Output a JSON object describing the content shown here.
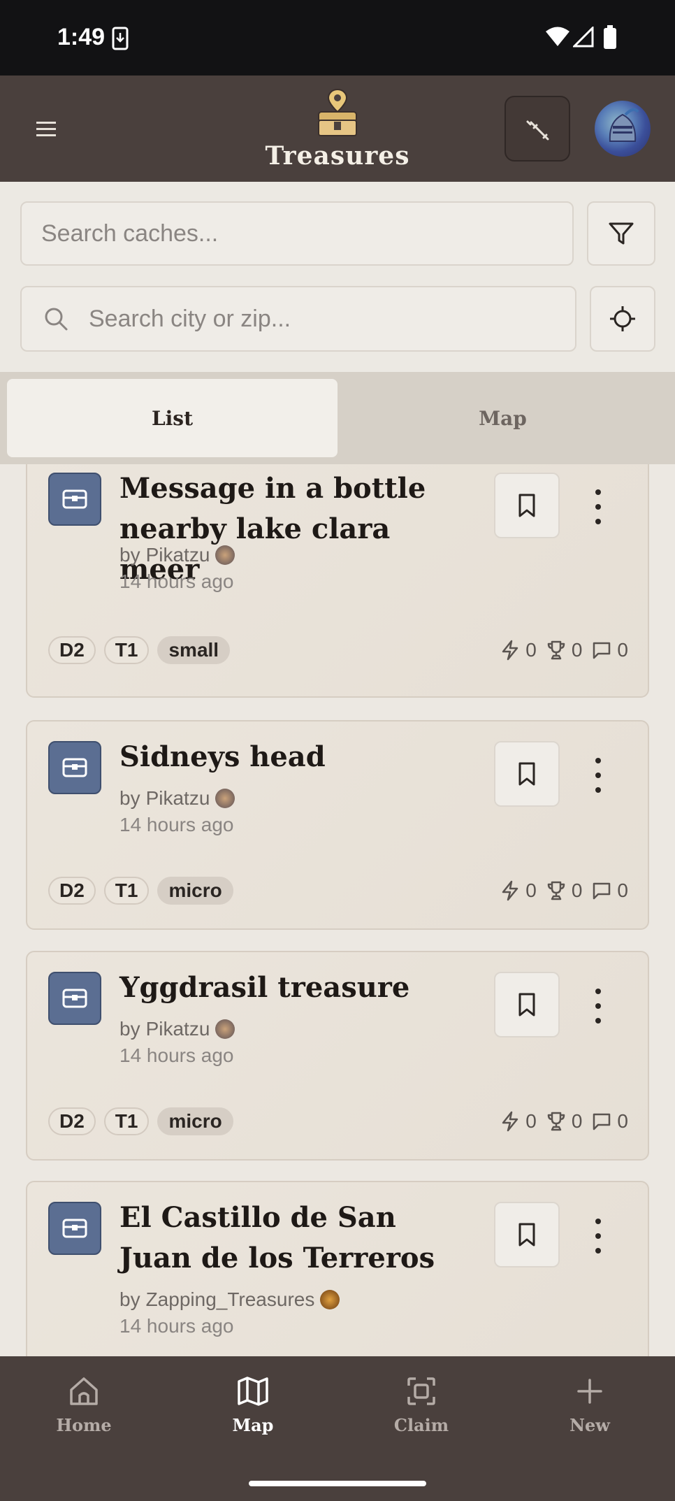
{
  "status_bar": {
    "time": "1:49"
  },
  "header": {
    "title": "Treasures"
  },
  "search": {
    "caches_placeholder": "Search caches...",
    "city_placeholder": "Search city or zip..."
  },
  "tabs": [
    {
      "label": "List",
      "active": true
    },
    {
      "label": "Map",
      "active": false
    }
  ],
  "caches": [
    {
      "title": "Message in a bottle nearby lake clara meer",
      "author_prefix": "by",
      "author": "Pikatzu",
      "time": "14 hours ago",
      "difficulty": "D2",
      "terrain": "T1",
      "size": "small",
      "flashes": "0",
      "trophies": "0",
      "comments": "0"
    },
    {
      "title": "Sidneys head",
      "author_prefix": "by",
      "author": "Pikatzu",
      "time": "14 hours ago",
      "difficulty": "D2",
      "terrain": "T1",
      "size": "micro",
      "flashes": "0",
      "trophies": "0",
      "comments": "0"
    },
    {
      "title": "Yggdrasil treasure",
      "author_prefix": "by",
      "author": "Pikatzu",
      "time": "14 hours ago",
      "difficulty": "D2",
      "terrain": "T1",
      "size": "micro",
      "flashes": "0",
      "trophies": "0",
      "comments": "0"
    },
    {
      "title": "El Castillo de San Juan de los Terreros",
      "author_prefix": "by",
      "author": "Zapping_Treasures",
      "time": "14 hours ago"
    }
  ],
  "bottom_nav": [
    {
      "label": "Home",
      "icon": "home-icon",
      "active": false
    },
    {
      "label": "Map",
      "icon": "map-icon",
      "active": true
    },
    {
      "label": "Claim",
      "icon": "scan-icon",
      "active": false
    },
    {
      "label": "New",
      "icon": "plus-icon",
      "active": false
    }
  ],
  "colors": {
    "header_bg": "#4a403d",
    "chest_badge": "#5b6e92",
    "page_bg": "#ece8e2"
  }
}
